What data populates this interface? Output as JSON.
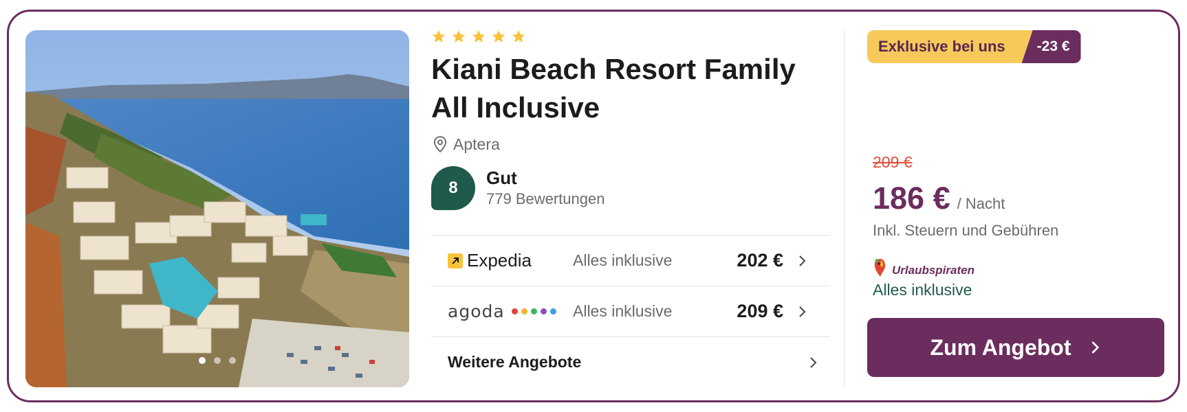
{
  "hotel": {
    "stars": 5,
    "name": "Kiani Beach Resort Family All Inclusive",
    "location": "Aptera",
    "rating": {
      "score": "8",
      "label": "Gut",
      "reviews": "779 Bewertungen"
    },
    "photo": {
      "carousel_index": 0,
      "carousel_count": 3
    }
  },
  "offers": [
    {
      "provider": "Expedia",
      "board": "Alles inklusive",
      "price": "202 €"
    },
    {
      "provider": "agoda",
      "board": "Alles inklusive",
      "price": "209 €"
    }
  ],
  "more_offers_label": "Weitere Angebote",
  "deal": {
    "badge": "Exklusive bei uns",
    "discount": "-23 €",
    "old_price": "209 €",
    "price": "186 €",
    "per_night": "/ Nacht",
    "taxes_note": "Inkl. Steuern und Gebühren",
    "provider": "Urlaubspiraten",
    "board": "Alles inklusive",
    "cta": "Zum Angebot"
  },
  "colors": {
    "brand": "#6b2c5e",
    "rating_badge": "#1f5a4c",
    "star": "#f7c33a",
    "deal_badge": "#f6c95a",
    "old_price": "#e04e3c"
  },
  "icons": {
    "stars": "star-icon",
    "location": "location-pin-icon",
    "chevron": "chevron-right-icon",
    "expedia": "expedia-logo-icon",
    "urlaubspiraten": "parrot-logo-icon"
  }
}
